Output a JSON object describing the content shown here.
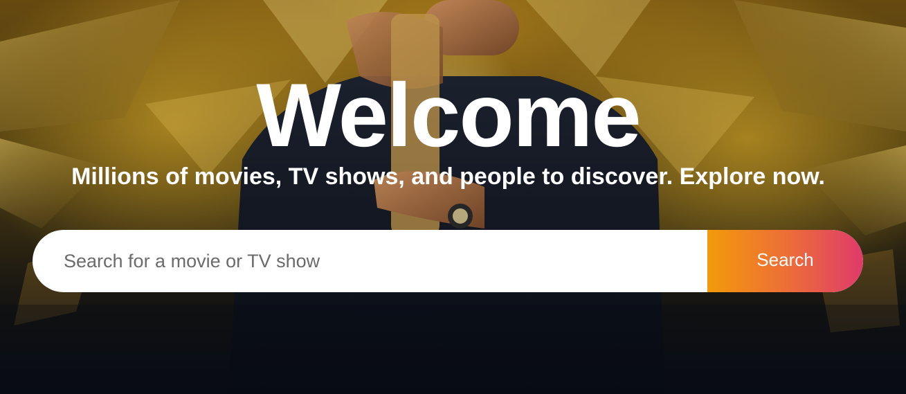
{
  "hero": {
    "title": "Welcome",
    "subtitle": "Millions of movies, TV shows, and people to discover. Explore now."
  },
  "search": {
    "placeholder": "Search for a movie or TV show",
    "value": "",
    "button_label": "Search"
  },
  "colors": {
    "button_gradient_start": "#f39a0a",
    "button_gradient_end": "#df3a6b",
    "text": "#ffffff",
    "input_background": "#ffffff"
  }
}
